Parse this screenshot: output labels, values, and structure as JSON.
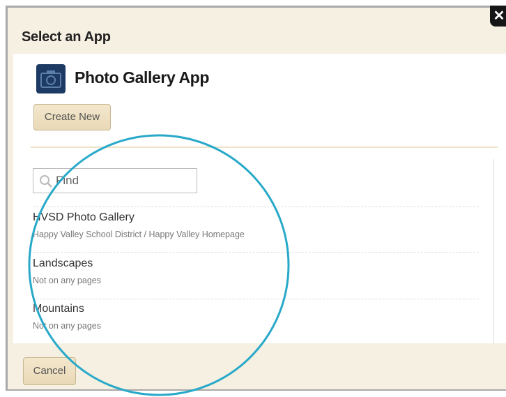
{
  "dialog": {
    "title": "Select an App",
    "close_label": "✕"
  },
  "app": {
    "icon": "camera-icon",
    "title": "Photo Gallery App"
  },
  "buttons": {
    "create_new": "Create New",
    "cancel": "Cancel"
  },
  "search": {
    "placeholder": "Find",
    "value": ""
  },
  "items": [
    {
      "name": "HVSD Photo Gallery",
      "location": "Happy Valley School District / Happy Valley Homepage"
    },
    {
      "name": "Landscapes",
      "location": "Not on any pages"
    },
    {
      "name": "Mountains",
      "location": "Not on any pages"
    }
  ],
  "colors": {
    "accent_circle": "#29a9c9",
    "button_bg": "#ede0c2",
    "panel_bg": "#f6f0e2",
    "app_icon_bg": "#1c3a63"
  }
}
